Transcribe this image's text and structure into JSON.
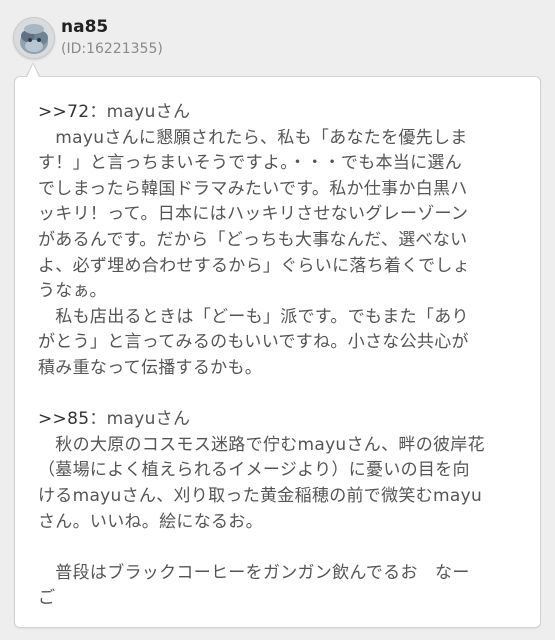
{
  "user": {
    "name": "na85",
    "id_text": "(ID:16221355)",
    "avatar_icon": "avatar-photo"
  },
  "post": {
    "lines": [
      {
        "type": "reply",
        "anchor": ">>72",
        "rest": "：mayuさん"
      },
      {
        "type": "text",
        "text": "　mayuさんに懇願されたら、私も「あなたを優先しま"
      },
      {
        "type": "text",
        "text": "す！」と言っちまいそうですよ。・・・でも本当に選ん"
      },
      {
        "type": "text",
        "text": "でしまったら韓国ドラマみたいです。私か仕事か白黒ハ"
      },
      {
        "type": "text",
        "text": "ッキリ！って。日本にはハッキリさせないグレーゾーン"
      },
      {
        "type": "text",
        "text": "があるんです。だから「どっちも大事なんだ、選べない"
      },
      {
        "type": "text",
        "text": "よ、必ず埋め合わせするから」ぐらいに落ち着くでしょ"
      },
      {
        "type": "text",
        "text": "うなぁ。"
      },
      {
        "type": "text",
        "text": "　私も店出るときは「どーも」派です。でもまた「あり"
      },
      {
        "type": "text",
        "text": "がとう」と言ってみるのもいいですね。小さな公共心が"
      },
      {
        "type": "text",
        "text": "積み重なって伝播するかも。"
      },
      {
        "type": "blank"
      },
      {
        "type": "reply",
        "anchor": ">>85",
        "rest": "：mayuさん"
      },
      {
        "type": "text",
        "text": "　秋の大原のコスモス迷路で佇むmayuさん、畔の彼岸花"
      },
      {
        "type": "text",
        "text": "（墓場によく植えられるイメージより）に憂いの目を向"
      },
      {
        "type": "text",
        "text": "けるmayuさん、刈り取った黄金稲穂の前で微笑むmayu"
      },
      {
        "type": "text",
        "text": "さん。いいね。絵になるお。"
      },
      {
        "type": "blank"
      },
      {
        "type": "text",
        "text": "　普段はブラックコーヒーをガンガン飲んでるお　なー"
      },
      {
        "type": "text",
        "text": "ご"
      }
    ]
  },
  "colors": {
    "background": "#eeeeee",
    "card": "#ffffff",
    "text": "#555555",
    "username": "#222222",
    "id": "#8a8a8a"
  }
}
